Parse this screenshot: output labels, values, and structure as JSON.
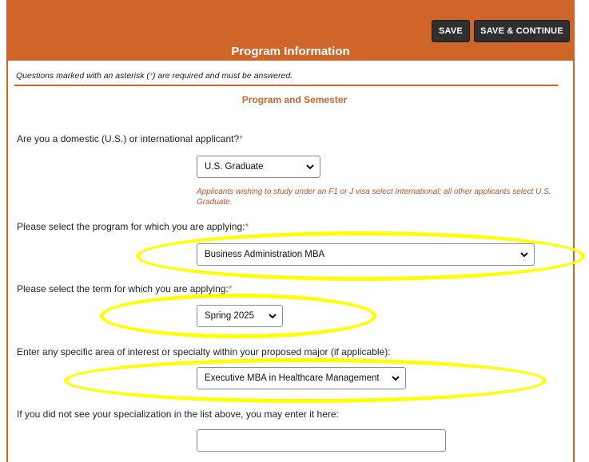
{
  "header": {
    "title": "Program Information",
    "save_label": "SAVE",
    "save_continue_label": "SAVE & CONTINUE",
    "accent_color": "#d0652a"
  },
  "notice": {
    "before": "Questions marked with an asterisk (",
    "asterisk": "*",
    "after": ") are required and must be answered."
  },
  "section_title": "Program and Semester",
  "questions": {
    "applicant_type": {
      "label": "Are you a domestic (U.S.) or international applicant?",
      "required_mark": "*",
      "value": "U.S. Graduate",
      "help": "Applicants wishing to study under an F1 or J visa select International; all other applicants select U.S. Graduate."
    },
    "program": {
      "label": "Please select the program for which you are applying:",
      "required_mark": "*",
      "value": "Business Administration MBA"
    },
    "term": {
      "label": "Please select the term for which you are applying:",
      "required_mark": "*",
      "value": "Spring 2025"
    },
    "specialty": {
      "label": "Enter any specific area of interest or specialty within your proposed major (if applicable):",
      "value": "Executive MBA in Healthcare Management"
    },
    "specialization_text": {
      "label": "If you did not see your specialization in the list above, you may enter it here:",
      "value": ""
    }
  },
  "highlight_color": "#ffff00"
}
